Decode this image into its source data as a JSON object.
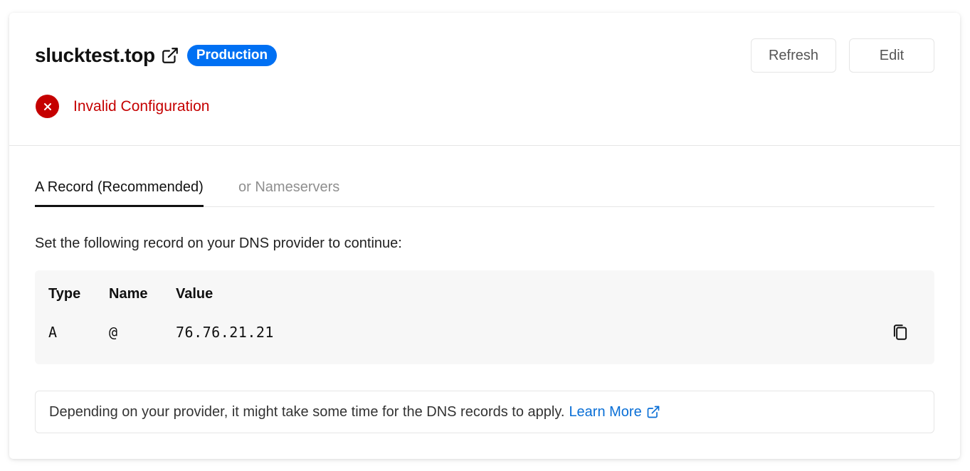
{
  "header": {
    "domain": "slucktest.top",
    "badge": "Production",
    "refresh_label": "Refresh",
    "edit_label": "Edit"
  },
  "status": {
    "text": "Invalid Configuration",
    "icon": "error-x-icon",
    "color": "#c50000"
  },
  "tabs": [
    {
      "label": "A Record (Recommended)",
      "active": true
    },
    {
      "label": "or Nameservers",
      "active": false
    }
  ],
  "instruction": "Set the following record on your DNS provider to continue:",
  "record_table": {
    "headers": [
      "Type",
      "Name",
      "Value"
    ],
    "rows": [
      {
        "type": "A",
        "name": "@",
        "value": "76.76.21.21"
      }
    ],
    "copy_icon": "copy-icon"
  },
  "note": {
    "text": "Depending on your provider, it might take some time for the DNS records to apply.",
    "link_label": "Learn More"
  },
  "colors": {
    "accent": "#0070f3",
    "error": "#c50000",
    "link": "#0a6fd6"
  }
}
